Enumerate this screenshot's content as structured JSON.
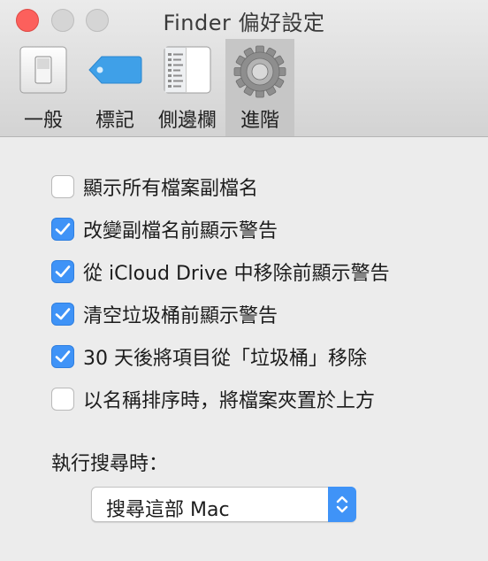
{
  "window": {
    "title": "Finder 偏好設定"
  },
  "tabs": [
    {
      "label": "一般",
      "icon": "light-switch-icon"
    },
    {
      "label": "標記",
      "icon": "tag-icon"
    },
    {
      "label": "側邊欄",
      "icon": "sidebar-list-icon"
    },
    {
      "label": "進階",
      "icon": "gear-icon",
      "active": true
    }
  ],
  "options": [
    {
      "label": "顯示所有檔案副檔名",
      "checked": false
    },
    {
      "label": "改變副檔名前顯示警告",
      "checked": true
    },
    {
      "label": "從 iCloud Drive 中移除前顯示警告",
      "checked": true
    },
    {
      "label": "清空垃圾桶前顯示警告",
      "checked": true
    },
    {
      "label": "30 天後將項目從「垃圾桶」移除",
      "checked": true
    },
    {
      "label": "以名稱排序時，將檔案夾置於上方",
      "checked": false
    }
  ],
  "search": {
    "label": "執行搜尋時：",
    "selected": "搜尋這部 Mac"
  },
  "colors": {
    "accent": "#3f93f7",
    "close": "#fc605c",
    "background": "#ececec"
  }
}
